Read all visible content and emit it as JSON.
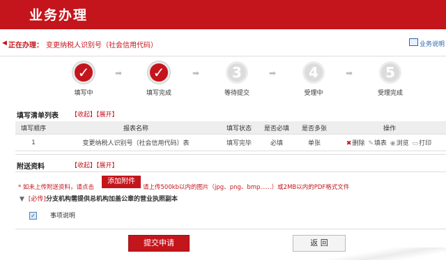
{
  "header": {
    "title": "业务办理"
  },
  "status": {
    "prefix": "正在办理：",
    "task": "变更纳税人识别号（社会信用代码）",
    "help_label": "业务说明"
  },
  "steps": [
    {
      "number": "✓",
      "label": "填写中",
      "state": "done"
    },
    {
      "number": "✓",
      "label": "填写完成",
      "state": "done"
    },
    {
      "number": "3",
      "label": "等待提交",
      "state": "todo"
    },
    {
      "number": "4",
      "label": "受理中",
      "state": "todo"
    },
    {
      "number": "5",
      "label": "受理完成",
      "state": "todo"
    }
  ],
  "form_list": {
    "title": "填写清单列表",
    "collapse": "【收起】",
    "expand": "【展开】",
    "headers": [
      "填写顺序",
      "报表名称",
      "填写状态",
      "是否必填",
      "是否多张",
      "操作"
    ],
    "rows": [
      {
        "order": "1",
        "name": "变更纳税人识别号（社会信用代码）表",
        "status": "填写完毕",
        "required": "必填",
        "multiple": "单张",
        "ops": {
          "delete": "删除",
          "fill": "填表",
          "view": "浏览",
          "print": "打印"
        }
      }
    ]
  },
  "attachments": {
    "title": "附送资料",
    "collapse": "【收起】",
    "expand": "【展开】",
    "notice_before": "* 如未上传附送资料，请点击",
    "add_button": "添加附件",
    "notice_after": "请上传500kb以内的图片（jpg、png、bmp......）或2MB以内的PDF格式文件",
    "required_tag": "[必传]",
    "required_text": "分支机构需提供总机构加盖公章的营业执照副本",
    "checkbox_label": "事项说明",
    "checkbox_checked": true
  },
  "buttons": {
    "submit": "提交申请",
    "back": "返 回"
  },
  "colors": {
    "brand": "#c4151c"
  }
}
